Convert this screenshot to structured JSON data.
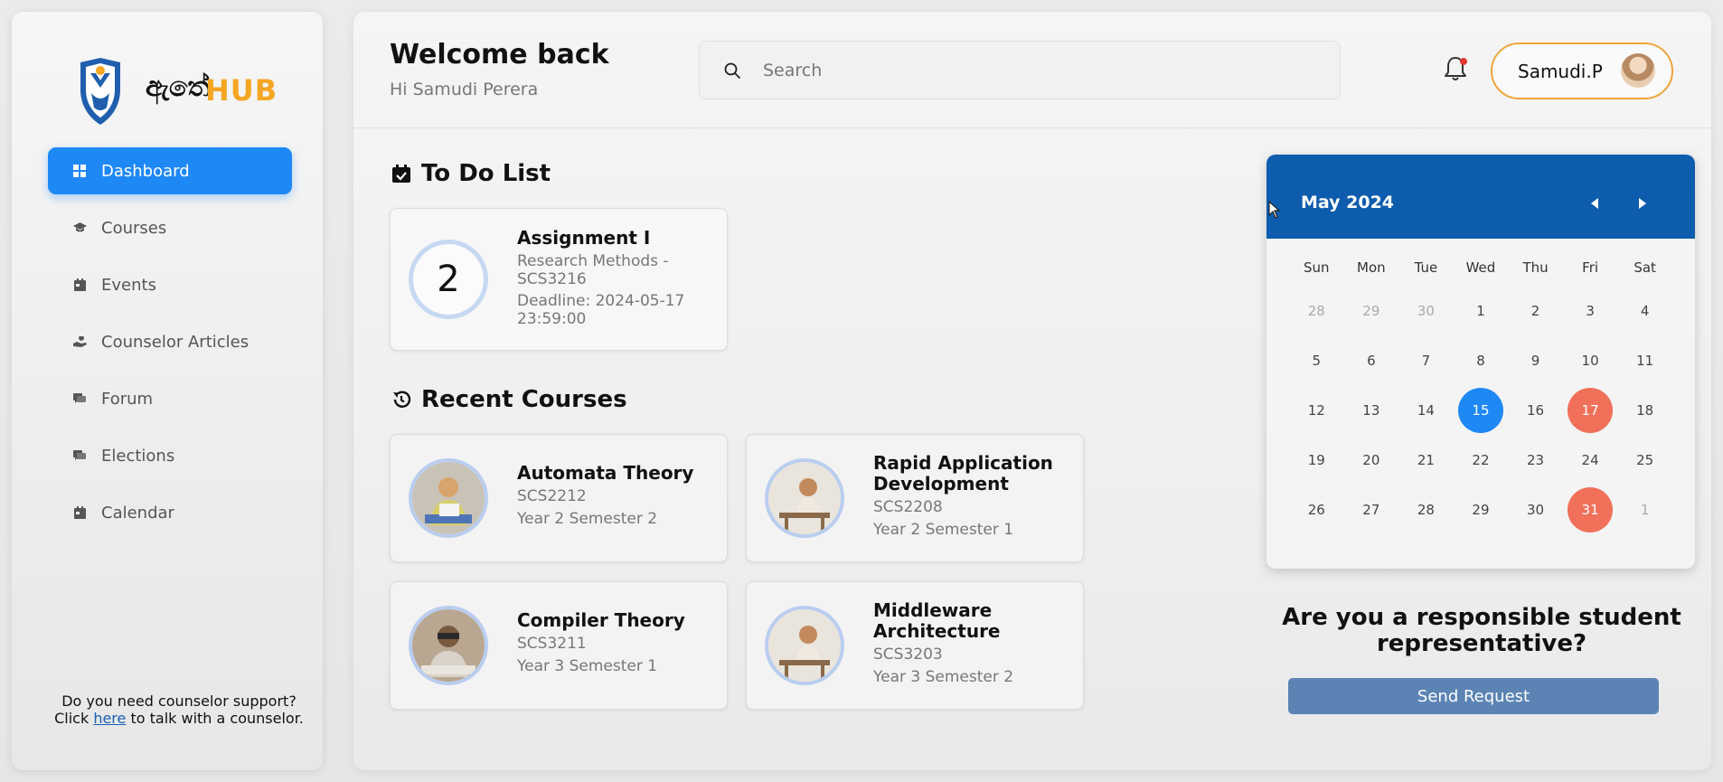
{
  "brand": {
    "logo_text": "HUB",
    "logo_sinhala": "ඇතේ"
  },
  "sidebar": {
    "items": [
      {
        "label": "Dashboard",
        "icon": "grid-icon",
        "active": true
      },
      {
        "label": "Courses",
        "icon": "graduation-cap-icon",
        "active": false
      },
      {
        "label": "Events",
        "icon": "calendar-icon",
        "active": false
      },
      {
        "label": "Counselor Articles",
        "icon": "hand-heart-icon",
        "active": false
      },
      {
        "label": "Forum",
        "icon": "chat-icon",
        "active": false
      },
      {
        "label": "Elections",
        "icon": "chat-icon",
        "active": false
      },
      {
        "label": "Calendar",
        "icon": "calendar-icon",
        "active": false
      }
    ],
    "support": {
      "line1": "Do you need counselor support?",
      "pre": "Click ",
      "link": "here",
      "post": " to talk with a counselor."
    }
  },
  "header": {
    "title": "Welcome back",
    "greeting": "Hi Samudi Perera",
    "search_placeholder": "Search",
    "user_name": "Samudi.P"
  },
  "todo": {
    "title": "To Do List",
    "items": [
      {
        "count": "2",
        "title": "Assignment I",
        "course": "Research Methods - SCS3216",
        "deadline": "Deadline: 2024-05-17 23:59:00"
      }
    ]
  },
  "recent": {
    "title": "Recent Courses",
    "courses": [
      {
        "name": "Automata Theory",
        "code": "SCS2212",
        "year": "Year 2 Semester 2"
      },
      {
        "name": "Rapid Application Development",
        "code": "SCS2208",
        "year": "Year 2 Semester 1"
      },
      {
        "name": "Compiler Theory",
        "code": "SCS3211",
        "year": "Year 3 Semester 1"
      },
      {
        "name": "Middleware Architecture",
        "code": "SCS3203",
        "year": "Year 3 Semester 2"
      }
    ]
  },
  "calendar": {
    "month": "May 2024",
    "days_of_week": [
      "Sun",
      "Mon",
      "Tue",
      "Wed",
      "Thu",
      "Fri",
      "Sat"
    ],
    "weeks": [
      [
        "28",
        "29",
        "30",
        "1",
        "2",
        "3",
        "4"
      ],
      [
        "5",
        "6",
        "7",
        "8",
        "9",
        "10",
        "11"
      ],
      [
        "12",
        "13",
        "14",
        "15",
        "16",
        "17",
        "18"
      ],
      [
        "19",
        "20",
        "21",
        "22",
        "23",
        "24",
        "25"
      ],
      [
        "26",
        "27",
        "28",
        "29",
        "30",
        "31",
        "1"
      ]
    ],
    "today": "15",
    "deadlines": [
      "17",
      "31"
    ],
    "colors": {
      "header": "#0d5cad",
      "today": "#1e88f5",
      "deadline": "#f0705a"
    }
  },
  "representative": {
    "question": "Are you a responsible student representative?",
    "button": "Send Request"
  }
}
